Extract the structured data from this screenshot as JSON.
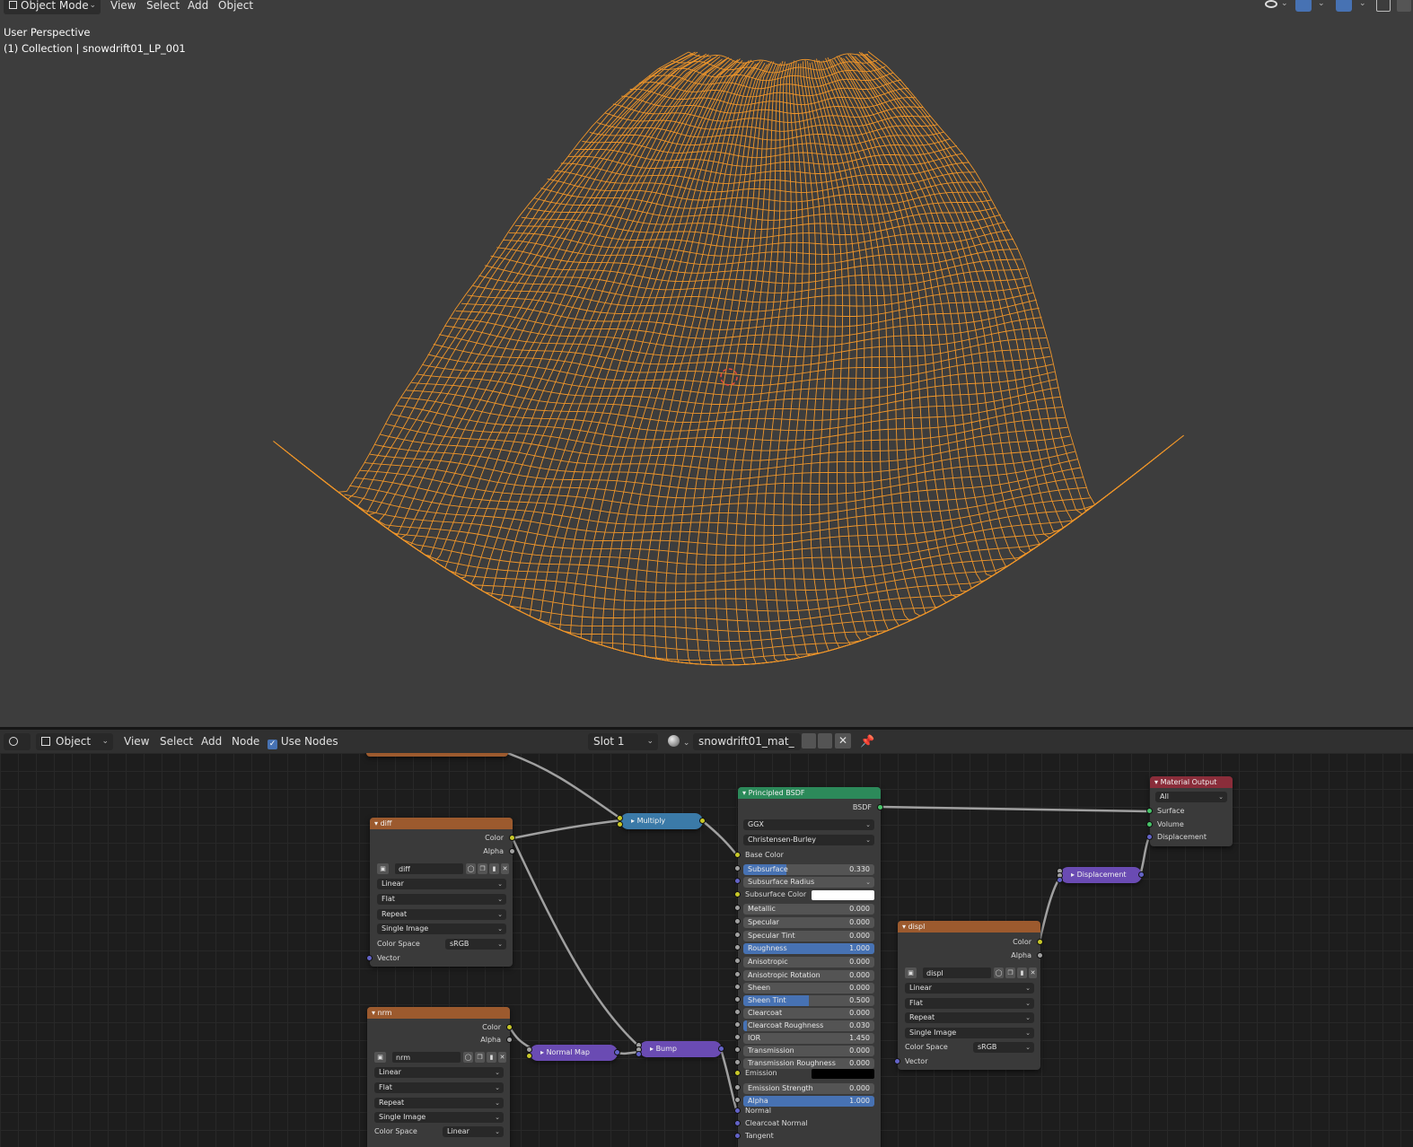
{
  "viewport": {
    "mode": "Object Mode",
    "menus": [
      "View",
      "Select",
      "Add",
      "Object"
    ],
    "perspective": "User Perspective",
    "collection": "(1) Collection | snowdrift01_LP_001",
    "colors": {
      "background": "#3d3d3d",
      "wire": "#f0962a",
      "origin": "#e84a3a"
    }
  },
  "node_editor": {
    "editor_type": "Object",
    "menus": [
      "View",
      "Select",
      "Add",
      "Node"
    ],
    "use_nodes_label": "Use Nodes",
    "use_nodes_checked": true,
    "slot": "Slot 1",
    "material": "snowdrift01_mat_"
  },
  "nodes": {
    "diff": {
      "title": "diff",
      "outputs": [
        "Color",
        "Alpha"
      ],
      "image": "diff",
      "interpolation": "Linear",
      "projection": "Flat",
      "extension": "Repeat",
      "source": "Single Image",
      "color_space_label": "Color Space",
      "color_space": "sRGB",
      "input": "Vector"
    },
    "nrm": {
      "title": "nrm",
      "outputs": [
        "Color",
        "Alpha"
      ],
      "image": "nrm",
      "interpolation": "Linear",
      "projection": "Flat",
      "extension": "Repeat",
      "source": "Single Image",
      "color_space_label": "Color Space",
      "color_space": "Linear"
    },
    "displ": {
      "title": "displ",
      "outputs": [
        "Color",
        "Alpha"
      ],
      "image": "displ",
      "interpolation": "Linear",
      "projection": "Flat",
      "extension": "Repeat",
      "source": "Single Image",
      "color_space_label": "Color Space",
      "color_space": "sRGB",
      "input": "Vector"
    },
    "multiply": {
      "title": "Multiply"
    },
    "normal_map": {
      "title": "Normal Map"
    },
    "bump": {
      "title": "Bump"
    },
    "displacement": {
      "title": "Displacement"
    },
    "bsdf": {
      "title": "Principled BSDF",
      "output": "BSDF",
      "distribution": "GGX",
      "subsurface_method": "Christensen-Burley",
      "base_color_label": "Base Color",
      "subsurface_radius_label": "Subsurface Radius",
      "subsurface_color_label": "Subsurface Color",
      "emission_label": "Emission",
      "params": [
        {
          "label": "Subsurface",
          "value": "0.330",
          "fraction": 0.33
        },
        {
          "label": "Metallic",
          "value": "0.000",
          "fraction": 0
        },
        {
          "label": "Specular",
          "value": "0.000",
          "fraction": 0
        },
        {
          "label": "Specular Tint",
          "value": "0.000",
          "fraction": 0
        },
        {
          "label": "Roughness",
          "value": "1.000",
          "fraction": 1
        },
        {
          "label": "Anisotropic",
          "value": "0.000",
          "fraction": 0
        },
        {
          "label": "Anisotropic Rotation",
          "value": "0.000",
          "fraction": 0
        },
        {
          "label": "Sheen",
          "value": "0.000",
          "fraction": 0
        },
        {
          "label": "Sheen Tint",
          "value": "0.500",
          "fraction": 0.5
        },
        {
          "label": "Clearcoat",
          "value": "0.000",
          "fraction": 0
        },
        {
          "label": "Clearcoat Roughness",
          "value": "0.030",
          "fraction": 0.03
        },
        {
          "label": "IOR",
          "value": "1.450",
          "fraction": 0
        },
        {
          "label": "Transmission",
          "value": "0.000",
          "fraction": 0
        },
        {
          "label": "Transmission Roughness",
          "value": "0.000",
          "fraction": 0
        },
        {
          "label": "Emission Strength",
          "value": "0.000",
          "fraction": 0
        },
        {
          "label": "Alpha",
          "value": "1.000",
          "fraction": 1
        }
      ],
      "vector_inputs": [
        "Normal",
        "Clearcoat Normal",
        "Tangent"
      ],
      "subsurface_color": "#ffffff",
      "emission_color": "#000000"
    },
    "output": {
      "title": "Material Output",
      "target": "All",
      "inputs": [
        "Surface",
        "Volume",
        "Displacement"
      ]
    }
  }
}
